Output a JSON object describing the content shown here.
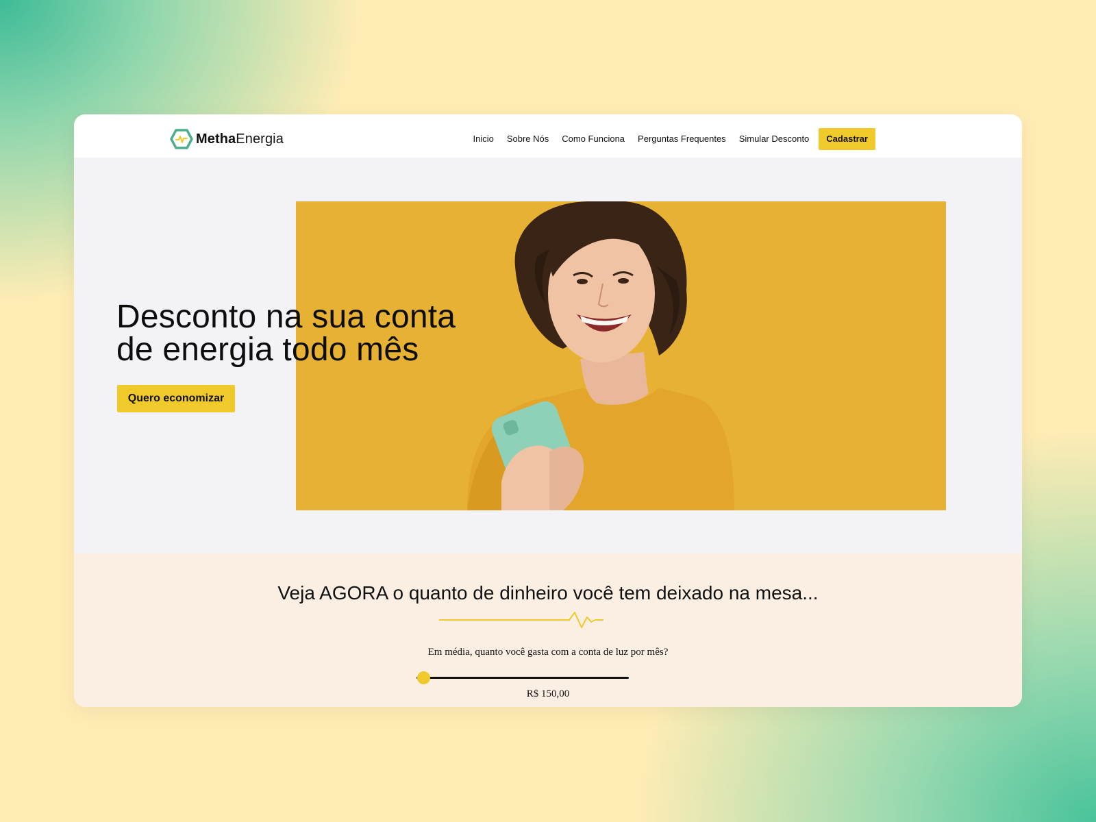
{
  "brand": {
    "name_bold": "Metha",
    "name_regular": "Energia",
    "icon": "hexagon-pulse-logo-icon",
    "color_primary": "#4caf8c",
    "color_accent": "#f0c92b"
  },
  "nav": {
    "links": [
      "Inicio",
      "Sobre Nós",
      "Como Funciona",
      "Perguntas Frequentes",
      "Simular Desconto"
    ],
    "cta_label": "Cadastrar"
  },
  "hero": {
    "title_line1": "Desconto na sua conta",
    "title_line2": "de energia todo mês",
    "button_label": "Quero economizar",
    "image": "woman-smiling-holding-phone-photo",
    "image_bg_color": "#e7b133"
  },
  "simulator": {
    "title": "Veja AGORA o quanto de dinheiro você tem deixado na mesa...",
    "question": "Em média, quanto você gasta com a conta de luz por mês?",
    "value_label": "R$ 150,00",
    "slider_position": 0.03
  }
}
